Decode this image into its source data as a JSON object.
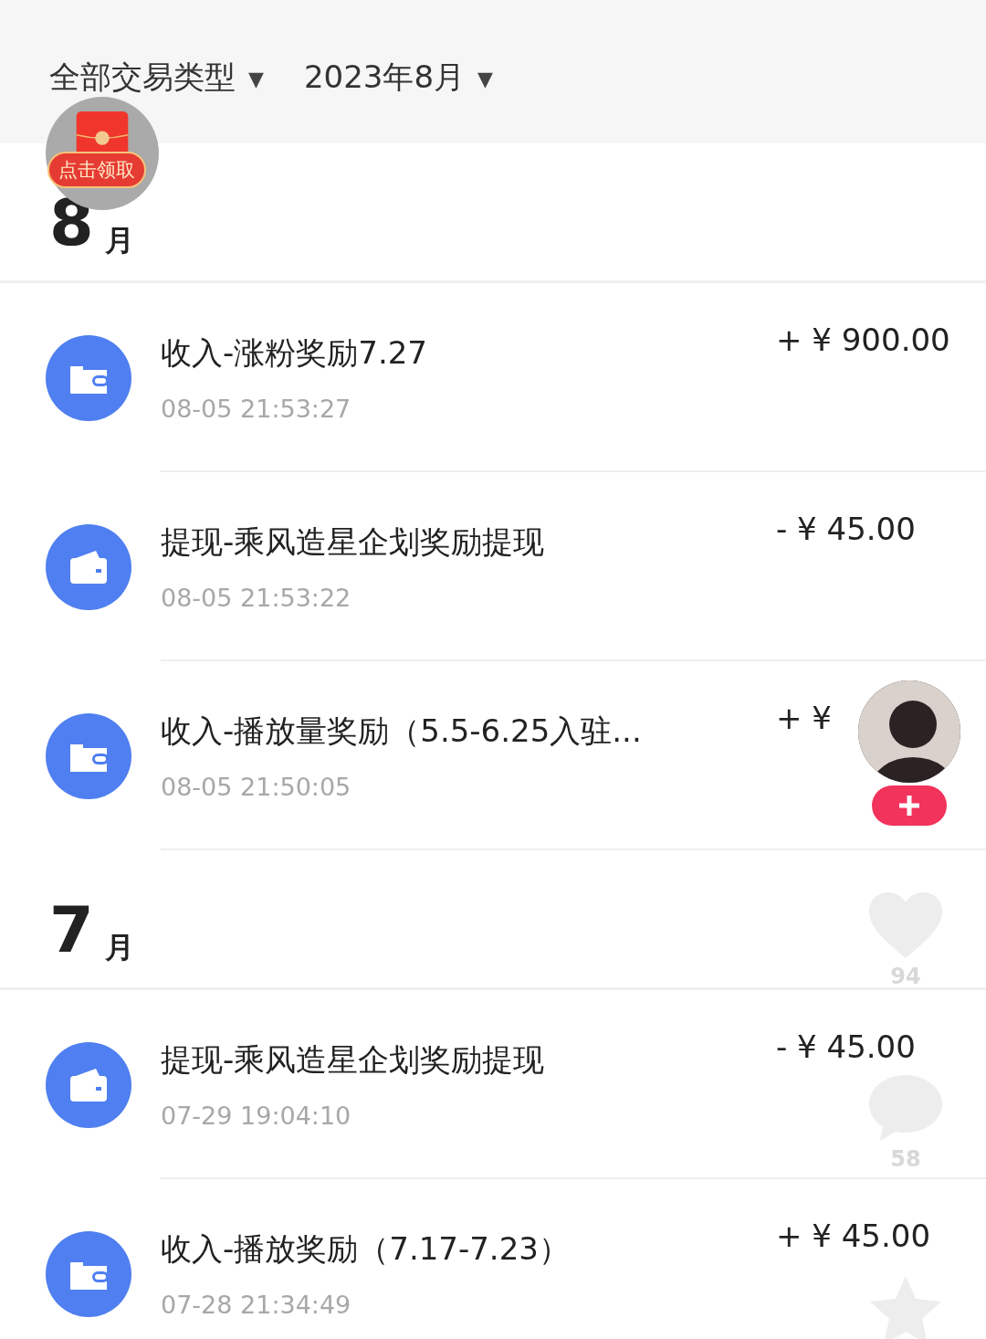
{
  "filters": [
    {
      "label": "全部交易类型",
      "caret": "▼"
    },
    {
      "label": "2023年8月",
      "caret": "▼"
    }
  ],
  "months": [
    {
      "number": "8",
      "unit": "月",
      "transactions": [
        {
          "kind": "income",
          "title": "收入-涨粉奖励7.27",
          "time": "08-05 21:53:27",
          "amount": "+ ¥ 900.00"
        },
        {
          "kind": "withdraw",
          "title": "提现-乘风造星企划奖励提现",
          "time": "08-05 21:53:22",
          "amount": "- ¥ 45.00"
        },
        {
          "kind": "income",
          "title": "收入-播放量奖励（5.5-6.25入驻...",
          "time": "08-05 21:50:05",
          "amount": "+ ¥"
        }
      ]
    },
    {
      "number": "7",
      "unit": "月",
      "transactions": [
        {
          "kind": "withdraw",
          "title": "提现-乘风造星企划奖励提现",
          "time": "07-29 19:04:10",
          "amount": "- ¥ 45.00"
        },
        {
          "kind": "income",
          "title": "收入-播放奖励（7.17-7.23）",
          "time": "07-28 21:34:49",
          "amount": "+ ¥ 45.00"
        }
      ]
    }
  ],
  "red_packet": {
    "label": "点击领取"
  },
  "side_actions": [
    {
      "kind": "like",
      "count": "94"
    },
    {
      "kind": "comment",
      "count": "58"
    },
    {
      "kind": "favorite"
    }
  ]
}
